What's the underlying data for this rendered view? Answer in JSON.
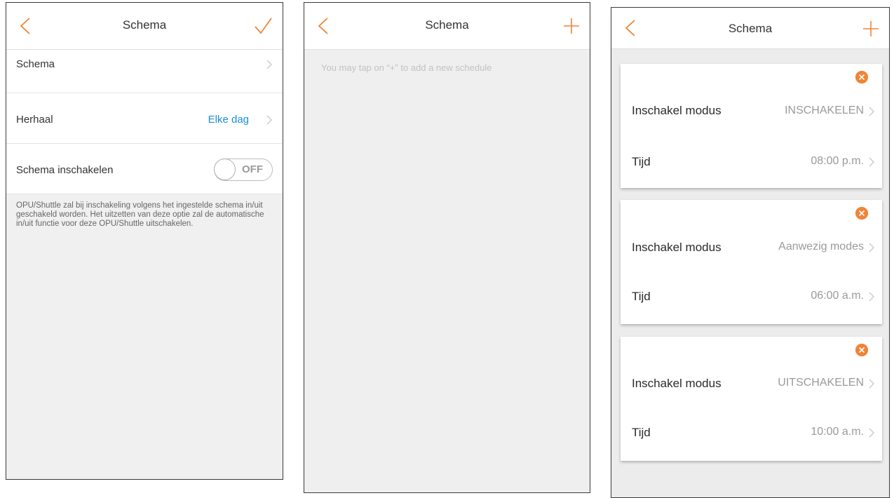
{
  "colors": {
    "accent": "#f08437",
    "link": "#1a90d6",
    "muted": "#9a9a9a"
  },
  "screen1": {
    "title": "Schema",
    "back_icon": "chevron-left-icon",
    "confirm_icon": "checkmark-icon",
    "rows": {
      "schema_label": "Schema",
      "repeat_label": "Herhaal",
      "repeat_value": "Elke dag",
      "enable_label": "Schema inschakelen",
      "toggle_state": "OFF"
    },
    "description": "OPU/Shuttle zal bij inschakeling volgens het ingestelde schema in/uit geschakeld worden. Het uitzetten van deze optie zal de automatische in/uit functie voor deze OPU/Shuttle uitschakelen."
  },
  "screen2": {
    "title": "Schema",
    "back_icon": "chevron-left-icon",
    "add_icon": "plus-icon",
    "hint": "You may tap on “+” to add a new schedule"
  },
  "screen3": {
    "title": "Schema",
    "back_icon": "chevron-left-icon",
    "add_icon": "plus-icon",
    "cards": [
      {
        "mode_label": "Inschakel modus",
        "mode_value": "INSCHAKELEN",
        "time_label": "Tijd",
        "time_value": "08:00 p.m."
      },
      {
        "mode_label": "Inschakel modus",
        "mode_value": "Aanwezig modes",
        "time_label": "Tijd",
        "time_value": "06:00 a.m."
      },
      {
        "mode_label": "Inschakel modus",
        "mode_value": "UITSCHAKELEN",
        "time_label": "Tijd",
        "time_value": "10:00 a.m."
      }
    ]
  }
}
